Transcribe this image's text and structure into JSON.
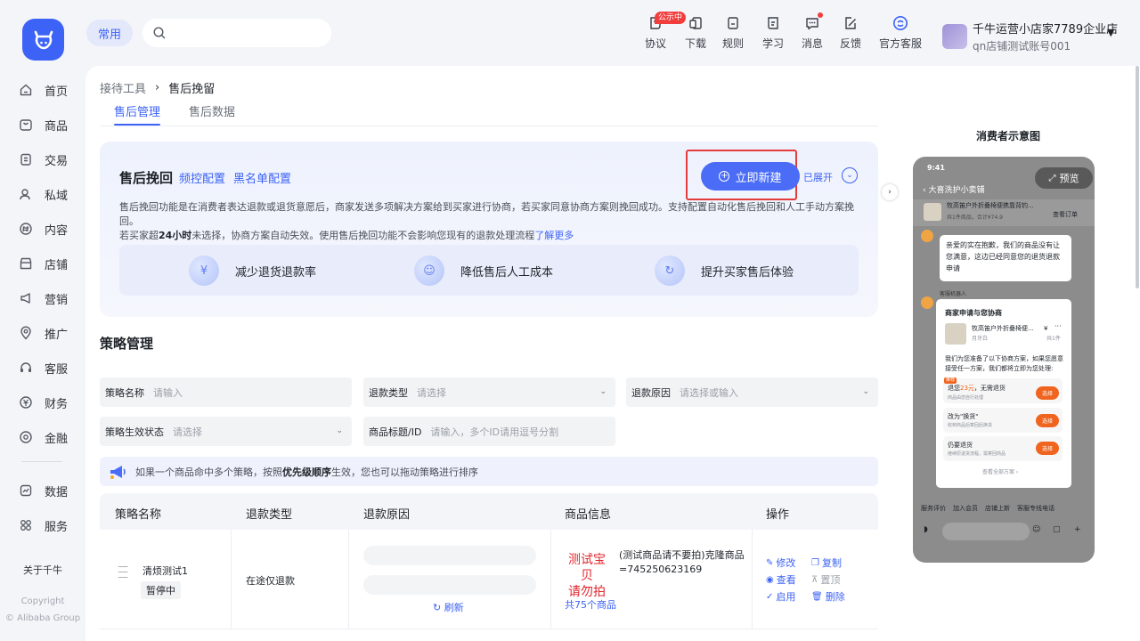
{
  "header": {
    "nav_pill": "常用",
    "search_placeholder": "",
    "icons": [
      {
        "label": "协议",
        "icon": "agreement-icon"
      },
      {
        "label": "下载",
        "icon": "download-icon"
      },
      {
        "label": "规则",
        "icon": "rules-icon"
      },
      {
        "label": "学习",
        "icon": "learn-icon"
      },
      {
        "label": "消息",
        "icon": "message-icon"
      },
      {
        "label": "反馈",
        "icon": "feedback-icon"
      },
      {
        "label": "官方客服",
        "icon": "official-service-icon"
      }
    ],
    "public_badge": "公示中",
    "user_name": "千牛运营小店家7789企业店",
    "user_account": "qn店铺测试账号001"
  },
  "sidebar": {
    "items": [
      {
        "label": "首页",
        "icon": "home-icon"
      },
      {
        "label": "商品",
        "icon": "goods-icon"
      },
      {
        "label": "交易",
        "icon": "trade-icon"
      },
      {
        "label": "私域",
        "icon": "private-domain-icon"
      },
      {
        "label": "内容",
        "icon": "content-icon"
      },
      {
        "label": "店铺",
        "icon": "shop-icon"
      },
      {
        "label": "营销",
        "icon": "marketing-icon"
      },
      {
        "label": "推广",
        "icon": "promotion-icon"
      },
      {
        "label": "客服",
        "icon": "customer-service-icon"
      },
      {
        "label": "财务",
        "icon": "finance-icon"
      },
      {
        "label": "金融",
        "icon": "banking-icon"
      },
      {
        "label": "数据",
        "icon": "data-icon"
      },
      {
        "label": "服务",
        "icon": "service-icon"
      }
    ],
    "about": "关于千牛",
    "copyright": "Copyright",
    "copyright_group": "© Alibaba Group"
  },
  "page": {
    "breadcrumb_parent": "接待工具",
    "breadcrumb_current": "售后挽留",
    "tabs": [
      "售后管理",
      "售后数据"
    ]
  },
  "intro": {
    "title": "售后挽回",
    "link_frequency": "频控配置",
    "link_blacklist": "黑名单配置",
    "new_button": "立即新建",
    "expanded": "已展开",
    "desc_line1": "售后挽回功能是在消费者表达退款或退货意愿后，商家发送多项解决方案给到买家进行协商，若买家同意协商方案则挽回成功。支持配置自动化售后挽回和人工手动方案挽回。",
    "desc_line2_a": "若买家超",
    "desc_line2_bold": "24小时",
    "desc_line2_b": "未选择，协商方案自动失效。使用售后挽回功能不会影响您现有的退款处理流程",
    "desc_more": "了解更多",
    "benefits": [
      "减少退货退款率",
      "降低售后人工成本",
      "提升买家售后体验"
    ]
  },
  "strategy": {
    "title": "策略管理",
    "filters": {
      "name_label": "策略名称",
      "name_placeholder": "请输入",
      "rtype_label": "退款类型",
      "rtype_placeholder": "请选择",
      "reason_label": "退款原因",
      "reason_placeholder": "请选择或输入",
      "status_label": "策略生效状态",
      "status_placeholder": "请选择",
      "product_label": "商品标题/ID",
      "product_placeholder": "请输入，多个ID请用逗号分割"
    },
    "tip_a": "如果一个商品命中多个策略，按照",
    "tip_bold": "优先级顺序",
    "tip_b": "生效，您也可以拖动策略进行排序",
    "columns": [
      "策略名称",
      "退款类型",
      "退款原因",
      "商品信息",
      "操作"
    ],
    "row": {
      "name": "清烦测试1",
      "status": "暂停中",
      "refund_type": "在途仅退款",
      "refresh": "刷新",
      "product_img_line1": "测试宝贝",
      "product_img_line2": "请勿拍",
      "product_name": "(测试商品请不要拍)克隆商品=745250623169",
      "product_count": "共75个商品",
      "ops": [
        "修改",
        "复制",
        "查看",
        "置顶",
        "启用",
        "删除"
      ]
    }
  },
  "phone": {
    "title": "消费者示意图",
    "time": "9:41",
    "preview": "预览",
    "shop": "大喜洗护小卖铺",
    "order_product": "牧高笛户外折叠椅便携靠背钓...",
    "order_meta": "共1件商品，合计¥74.9",
    "view_order": "查看订单",
    "msg1": "亲爱的实在抱歉，我们的商品没有让您满意，这边已经同意您的退货退款申请",
    "bot_label": "客服机器人",
    "card_title": "商家申请与您协商",
    "card_product": "牧高笛户外折叠椅便...",
    "card_product_price": "¥",
    "card_sku": "月牙白",
    "card_qty": "共1件",
    "card_desc": "我们为您准备了以下协商方案，如果您愿意接受任一方案，我们都将立即为您处理:",
    "opt1_tag": "推荐",
    "opt1_title_a": "退您",
    "opt1_amount": "23元",
    "opt1_title_b": "，无需退货",
    "opt1_sub": "商品由您自行处理",
    "opt2_title": "改为\"换货\"",
    "opt2_sub": "收到商品后寄回后换货",
    "opt3_title": "仍要退货",
    "opt3_sub": "继续原退货流程，需寄回商品",
    "choose": "选择",
    "see_all": "查看全部方案 ›",
    "bottom_links": [
      "服务评价",
      "加入会员",
      "店铺上新",
      "客服专线电话"
    ]
  },
  "colors": {
    "accent": "#3d63f6",
    "danger": "#e43b3b",
    "bg": "#f4f5f9"
  }
}
